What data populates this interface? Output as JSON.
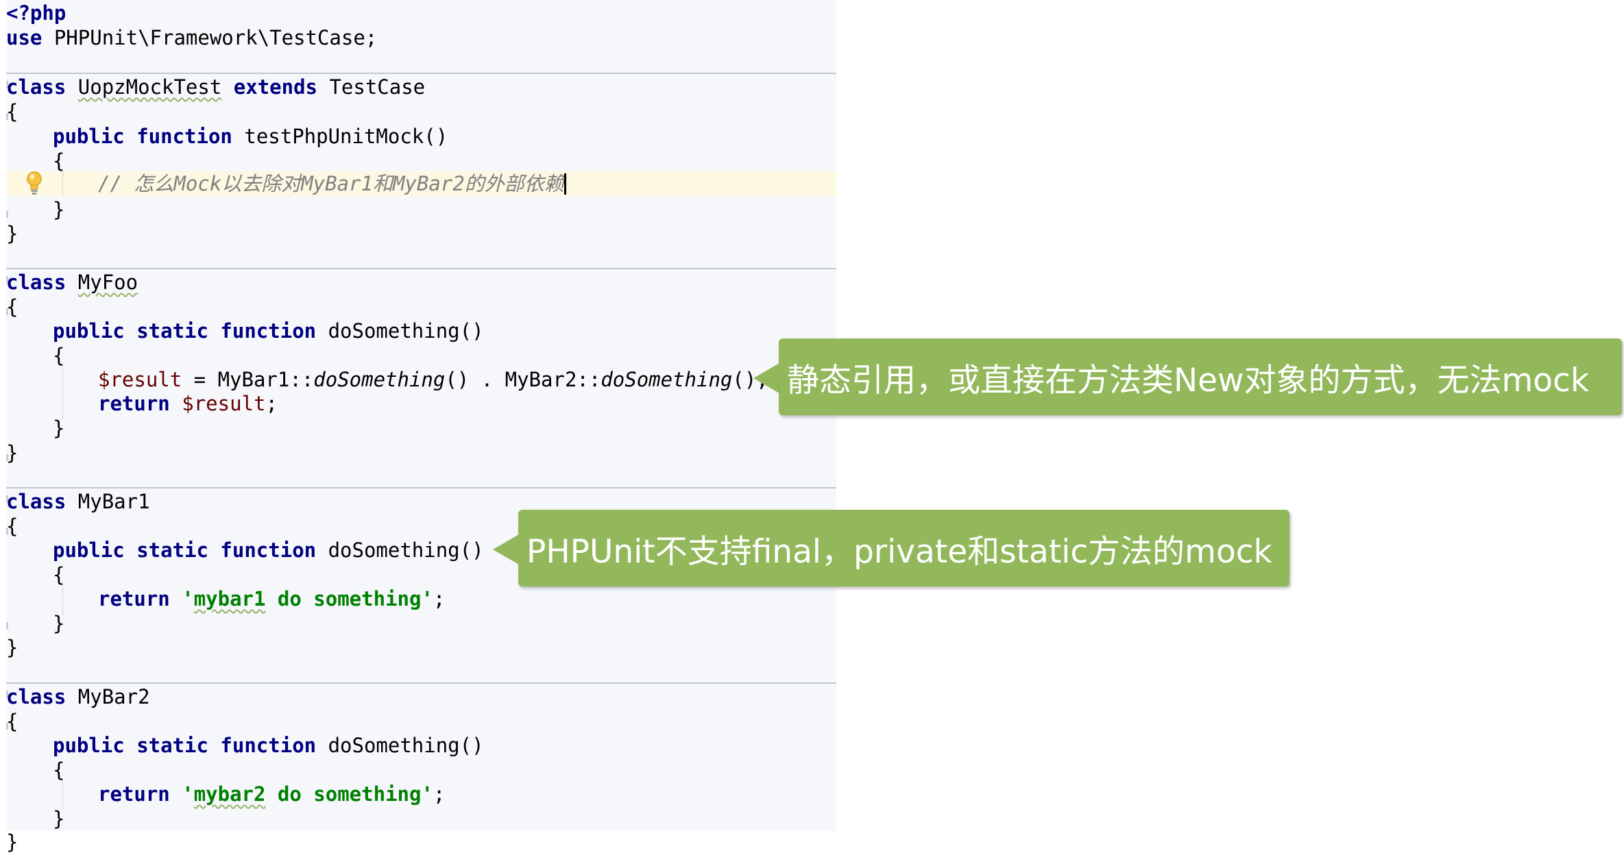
{
  "code": {
    "l1": "<?php",
    "l2_kw": "use",
    "l2_rest": " PHPUnit\\Framework\\TestCase;",
    "c1_kw1": "class",
    "c1_name": "UopzMockTest",
    "c1_kw2": "extends",
    "c1_parent": "TestCase",
    "brace_open": "{",
    "brace_close": "}",
    "m1_kw": "public function",
    "m1_name": "testPhpUnitMock()",
    "comment": "// 怎么Mock以去除对MyBar1和MyBar2的外部依赖",
    "c2_kw": "class",
    "c2_name": "MyFoo",
    "static_kw": "public static function",
    "method_name": "doSomething()",
    "foo_var": "$result",
    "foo_eq": " = MyBar1::",
    "foo_call1": "doSomething",
    "foo_mid": "() . MyBar2::",
    "foo_call2": "doSomething",
    "foo_end": "();",
    "return_kw": "return",
    "foo_ret_var": "$result",
    "semicolon": ";",
    "c3_kw": "class",
    "c3_name": "MyBar1",
    "bar1_q1": "'",
    "bar1_word": "mybar1",
    "bar1_rest": " do something'",
    "c4_kw": "class",
    "c4_name": "MyBar2",
    "bar2_q1": "'",
    "bar2_word": "mybar2",
    "bar2_rest": " do something'"
  },
  "callouts": {
    "top": "静态引用，或直接在方法类New对象的方式，无法mock",
    "bottom": "PHPUnit不支持final，private和static方法的mock"
  },
  "colors": {
    "editor_bg": "#f5f7fb",
    "keyword": "#000080",
    "string": "#008000",
    "comment": "#808080",
    "variable": "#660000",
    "callout_bg": "#92b85b",
    "current_line": "#fdf8e1"
  },
  "icons": {
    "intention_bulb": "lightbulb-icon"
  }
}
